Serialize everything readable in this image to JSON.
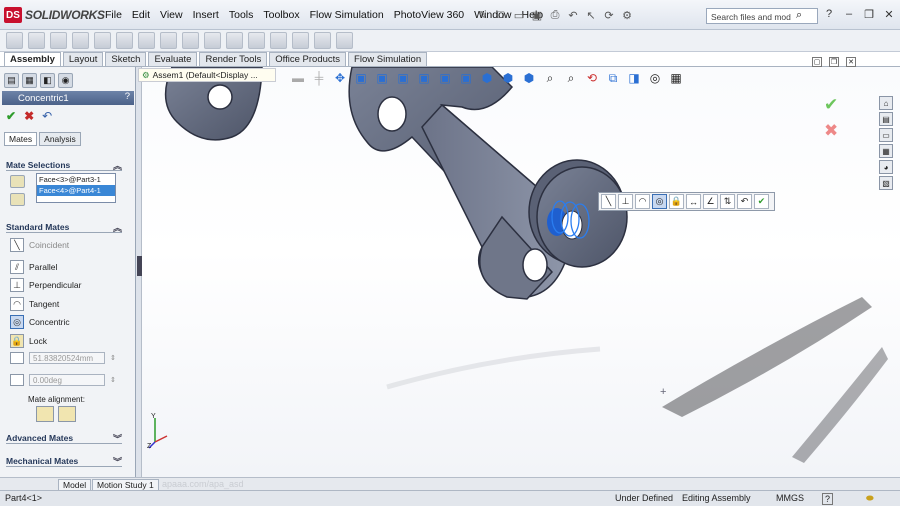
{
  "app": {
    "brand": "SOLIDWORKS",
    "logo_letters": "DS"
  },
  "menu": [
    "File",
    "Edit",
    "View",
    "Insert",
    "Tools",
    "Toolbox",
    "Flow Simulation",
    "PhotoView 360",
    "Window",
    "Help"
  ],
  "search": {
    "placeholder": "Search files and mod"
  },
  "command_tabs": [
    "Assembly",
    "Layout",
    "Sketch",
    "Evaluate",
    "Render Tools",
    "Office Products",
    "Flow Simulation"
  ],
  "command_tabs_active": "Assembly",
  "property_manager": {
    "title": "Concentric1",
    "help": "?",
    "subtabs": [
      "Mates",
      "Analysis"
    ],
    "mate_selections": {
      "label": "Mate Selections",
      "items": [
        "Face<3>@Part3-1",
        "Face<4>@Part4-1"
      ]
    },
    "standard_mates": {
      "label": "Standard Mates",
      "items": [
        "Coincident",
        "Parallel",
        "Perpendicular",
        "Tangent",
        "Concentric",
        "Lock"
      ],
      "selected": "Concentric",
      "distance_value": "51.83820524mm",
      "angle_value": "0.00deg",
      "alignment_label": "Mate alignment:"
    },
    "advanced_mates_label": "Advanced Mates",
    "mechanical_mates_label": "Mechanical Mates"
  },
  "feature_tree": {
    "item": "Assem1  (Default<Display ..."
  },
  "bottom_tabs": [
    "Model",
    "Motion Study 1"
  ],
  "status": {
    "part": "Part4<1>",
    "state": "Under Defined",
    "mode": "Editing Assembly",
    "units": "MMGS",
    "help": "?"
  },
  "watermark": "apaaa.com/apa_asd"
}
